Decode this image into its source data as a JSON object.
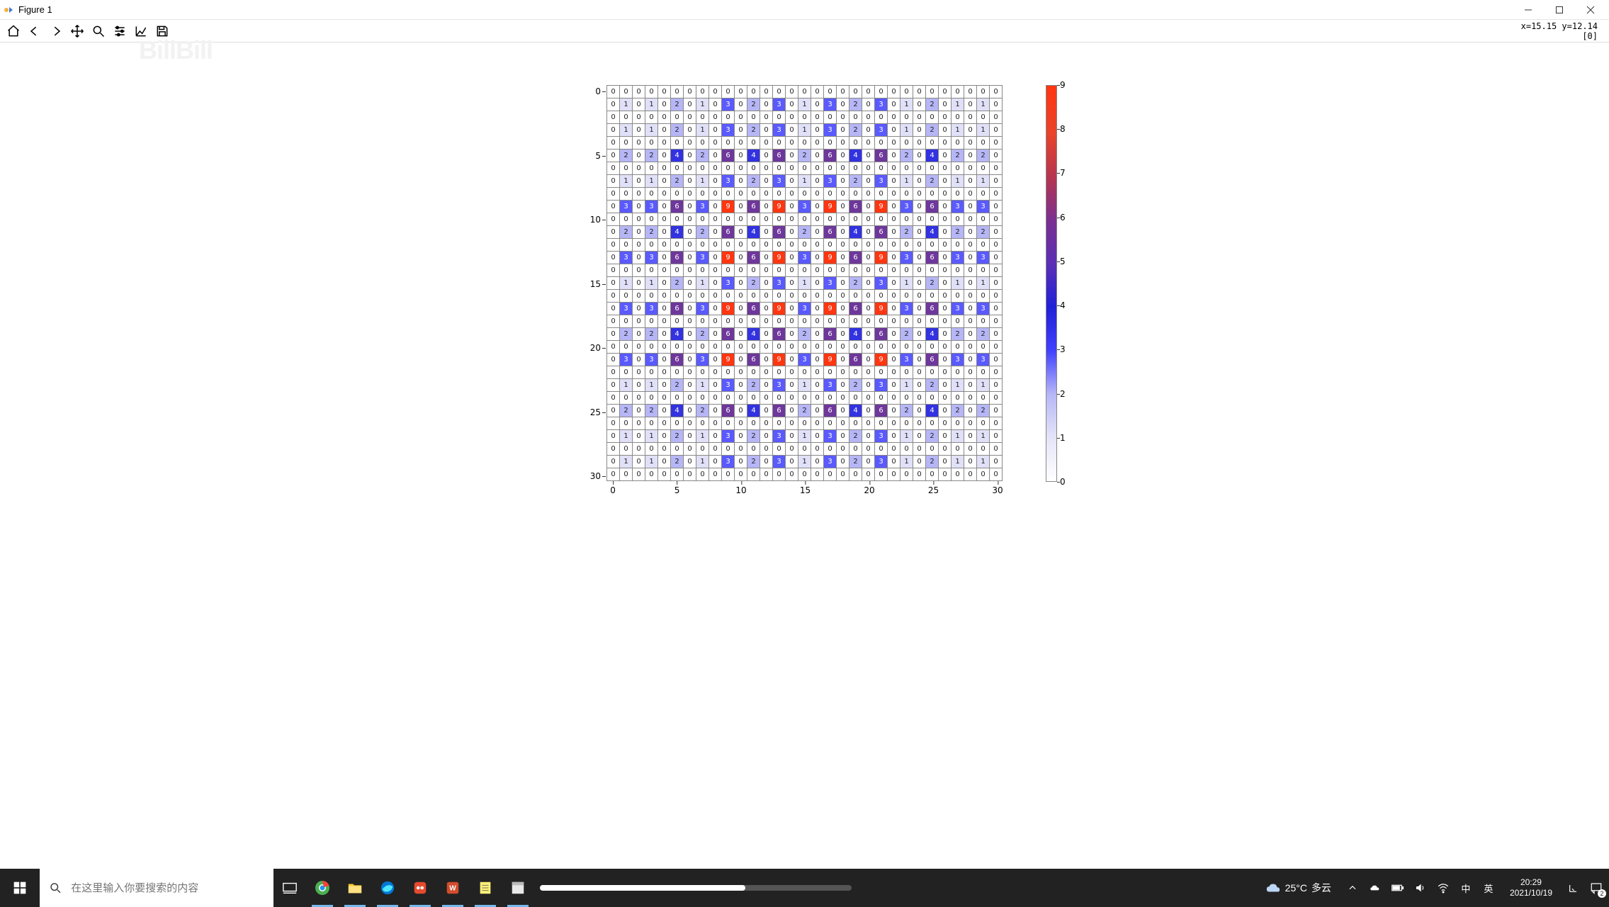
{
  "window": {
    "title": "Figure 1"
  },
  "toolbar": {
    "buttons": [
      "home",
      "back",
      "forward",
      "pan",
      "zoom",
      "configure",
      "axes",
      "save"
    ],
    "coords_line1": "x=15.15 y=12.14",
    "coords_line2": "[0]"
  },
  "watermark": "BillBill",
  "taskbar": {
    "search_placeholder": "在这里输入你要搜索的内容",
    "weather_temp": "25°C",
    "weather_desc": "多云",
    "ime_lang": "中",
    "ime_sub": "英",
    "time": "20:29",
    "date": "2021/10/19",
    "progress_pct": 66,
    "notification_count": "2"
  },
  "chart_data": {
    "type": "heatmap",
    "title": "",
    "xlabel": "",
    "ylabel": "",
    "x_range": [
      0,
      30
    ],
    "y_range": [
      0,
      30
    ],
    "xticks": [
      0,
      5,
      10,
      15,
      20,
      25,
      30
    ],
    "yticks": [
      0,
      5,
      10,
      15,
      20,
      25,
      30
    ],
    "colorbar": {
      "vmin": 0,
      "vmax": 9,
      "ticks": [
        0,
        1,
        2,
        3,
        4,
        5,
        6,
        7,
        8,
        9
      ]
    },
    "note": "31x31 integer grid; row 0 = all zeros (top), row 30 = all zeros (bottom); rows alternate with recurring pattern rows at 1,3,5,7,9,11,13,15,17,19,21,23,25,27,29; see matrix.",
    "row_zero": [
      0,
      0,
      0,
      0,
      0,
      0,
      0,
      0,
      0,
      0,
      0,
      0,
      0,
      0,
      0,
      0,
      0,
      0,
      0,
      0,
      0,
      0,
      0,
      0,
      0,
      0,
      0,
      0,
      0,
      0,
      0
    ],
    "row_pat1": [
      0,
      1,
      0,
      1,
      0,
      2,
      0,
      1,
      0,
      3,
      0,
      2,
      0,
      3,
      0,
      1,
      0,
      3,
      0,
      2,
      0,
      3,
      0,
      1,
      0,
      2,
      0,
      1,
      0,
      1,
      0
    ],
    "row_pat4": [
      0,
      2,
      0,
      2,
      0,
      4,
      0,
      2,
      0,
      6,
      0,
      4,
      0,
      6,
      0,
      2,
      0,
      6,
      0,
      4,
      0,
      6,
      0,
      2,
      0,
      4,
      0,
      2,
      0,
      2,
      0
    ],
    "row_pat9": [
      0,
      3,
      0,
      3,
      0,
      6,
      0,
      3,
      0,
      9,
      0,
      6,
      0,
      9,
      0,
      3,
      0,
      9,
      0,
      6,
      0,
      9,
      0,
      3,
      0,
      6,
      0,
      3,
      0,
      3,
      0
    ],
    "matrix_indices": {
      "0": "row_zero",
      "1": "row_pat1",
      "2": "row_zero",
      "3": "row_pat1",
      "4": "row_zero",
      "5": "row_pat4",
      "6": "row_zero",
      "7": "row_pat1",
      "8": "row_zero",
      "9": "row_pat9",
      "10": "row_zero",
      "11": "row_pat4",
      "12": "row_zero",
      "13": "row_pat9",
      "14": "row_zero",
      "15": "row_pat1",
      "16": "row_zero",
      "17": "row_pat9",
      "18": "row_zero",
      "19": "row_pat4",
      "20": "row_zero",
      "21": "row_pat9",
      "22": "row_zero",
      "23": "row_pat1",
      "24": "row_zero",
      "25": "row_pat4",
      "26": "row_zero",
      "27": "row_pat1",
      "28": "row_zero",
      "29": "row_pat1",
      "30": "row_zero"
    }
  }
}
